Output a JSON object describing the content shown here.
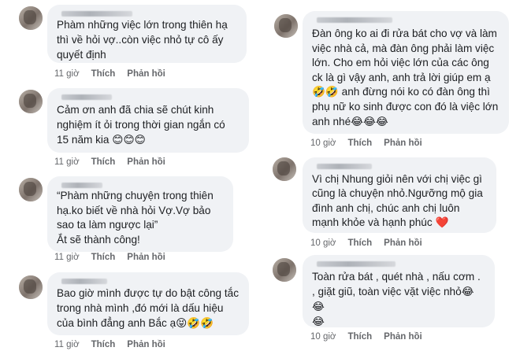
{
  "left_column": [
    {
      "text": "Phàm những việc lớn trong thiên hạ thì về hỏi vợ..còn việc nhỏ tự cô ấy quyết định",
      "time": "11 giờ",
      "like": "Thích",
      "reply": "Phản hồi"
    },
    {
      "text": "Cảm ơn anh đã chia sẽ chút kinh nghiệm ít ỏi trong thời gian ngắn có 15 năm kia 😊😊😊",
      "time": "11 giờ",
      "like": "Thích",
      "reply": "Phản hồi"
    },
    {
      "text": "“Phàm những chuyện trong thiên hạ.ko biết về nhà hỏi Vợ.Vợ bảo sao ta làm ngược lại”\nẮt sẽ thành công!",
      "time": "11 giờ",
      "like": "Thích",
      "reply": "Phản hồi"
    },
    {
      "text": "Bao giờ mình được tự do bật công tắc trong nhà mình ,đó mới là dấu hiệu của bình đẳng anh Bắc ạ😝🤣🤣",
      "time": "11 giờ",
      "like": "Thích",
      "reply": "Phản hồi"
    }
  ],
  "right_column": [
    {
      "text": "Đàn ông ko ai đi rửa bát cho vợ và làm việc nhà cả, mà đàn ông phải làm việc lớn. Cho em hỏi việc lớn của các ông ck là gì vậy anh, anh trả lời giúp em ạ 🤣🤣 anh đừng nói ko có đàn ông thì phụ nữ ko sinh được con đó là việc lớn anh nhé😂😂😂",
      "time": "10 giờ",
      "like": "Thích",
      "reply": "Phản hồi"
    },
    {
      "text": "Vì chị Nhung giỏi nên với chị việc gì cũng là chuyện nhỏ.Ngưỡng mộ gia đình anh chị, chúc anh chị luôn mạnh khỏe và hạnh phúc ❤️",
      "time": "10 giờ",
      "like": "Thích",
      "reply": "Phản hồi"
    },
    {
      "text": "Toàn rửa bát , quét nhà , nấu cơm .\n, giặt giũ, toàn việc vặt việc nhỏ😂😂\n😂",
      "time": "10 giờ",
      "like": "Thích",
      "reply": "Phản hồi"
    }
  ]
}
